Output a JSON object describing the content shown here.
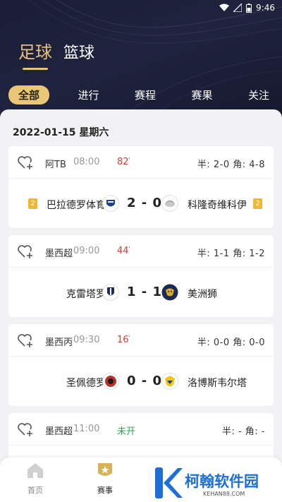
{
  "status_bar": {
    "time": "9:46"
  },
  "sport_tabs": [
    "足球",
    "篮球"
  ],
  "filter_tabs": [
    "全部",
    "进行",
    "赛程",
    "赛果",
    "关注"
  ],
  "date_line": "2022-01-15 星期六",
  "matches": [
    {
      "league": "阿TB",
      "time": "08:00",
      "minute": "82",
      "half_corner": "半: 2-0  角: 4-8",
      "home": "巴拉德罗体育",
      "away": "科隆奇维科伊",
      "score": "2 - 0",
      "home_rank": "2",
      "away_rank": "2"
    },
    {
      "league": "墨西超",
      "time": "09:00",
      "minute": "44",
      "half_corner": "半: 1-1  角: 1-2",
      "home": "克雷塔罗",
      "away": "美洲狮",
      "score": "1 - 1"
    },
    {
      "league": "墨西丙",
      "time": "09:30",
      "minute": "16",
      "half_corner": "半: 0-0  角: 0-0",
      "home": "圣佩德罗",
      "away": "洛博斯韦尔塔",
      "score": "0 - 0"
    },
    {
      "league": "墨西超",
      "time": "11:00",
      "minute": "未开",
      "half_corner": "半: -  角: -"
    }
  ],
  "bottom_nav": [
    {
      "label": "首页",
      "icon": "home-icon"
    },
    {
      "label": "赛事",
      "icon": "star-shield-icon"
    }
  ],
  "watermark": {
    "text": "柯翰软件园",
    "url": "KEHAN88.COM"
  },
  "colors": {
    "accent_gold": "#e6c27a",
    "header_bg": "#1a1d35",
    "live_red": "#e03a2f",
    "watermark_blue": "#1d6fd6"
  }
}
